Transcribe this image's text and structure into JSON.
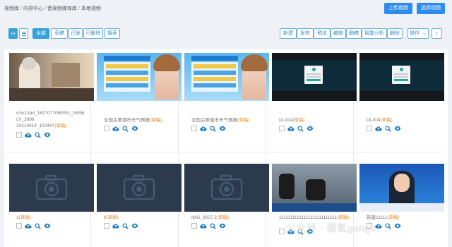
{
  "breadcrumb": [
    "视频库",
    "内容中心",
    "音视频媒体库",
    "本地视频"
  ],
  "header_buttons": {
    "upload": "上传视频",
    "select": "选择视频"
  },
  "filters": [
    "全部",
    "草稿",
    "已发",
    "已删除",
    "搜索"
  ],
  "actions": [
    "新建",
    "发布",
    "预览",
    "编辑",
    "删稿",
    "智能分析",
    "删除"
  ],
  "operation_menu": "操作",
  "next_icon": "chevron-right-icon",
  "draft_label": "(草稿)",
  "videos": [
    {
      "title": "cctv13ad_1617077069051_b838rLV_2699",
      "subtitle": "20210414_100447",
      "thumb": "scene"
    },
    {
      "title": "全国主要城市天气预报",
      "subtitle": "",
      "thumb": "weather"
    },
    {
      "title": "全国主要城市天气预报",
      "subtitle": "",
      "thumb": "weather"
    },
    {
      "title": "DI-004",
      "subtitle": "",
      "thumb": "login"
    },
    {
      "title": "DI-004",
      "subtitle": "",
      "thumb": "login"
    },
    {
      "title": "1",
      "subtitle": "",
      "thumb": "camera"
    },
    {
      "title": "6",
      "subtitle": "",
      "thumb": "camera"
    },
    {
      "title": "IMG_3927 2",
      "subtitle": "",
      "thumb": "camera"
    },
    {
      "title": "11111111111111111111111111",
      "subtitle": "",
      "thumb": "news"
    },
    {
      "title": "新建11111",
      "subtitle": "",
      "thumb": "anchor"
    }
  ],
  "watermark": "公众号 · 强氧gangs",
  "colors": {
    "primary": "#2d8cf0",
    "filter_active": "#35a2d8",
    "draft": "#e8881a",
    "icon_blue": "#1c7ec2"
  }
}
